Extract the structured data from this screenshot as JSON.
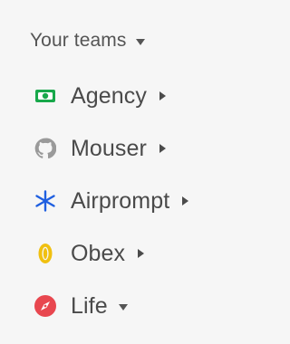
{
  "section": {
    "title": "Your teams",
    "expanded": true,
    "caret_icon": "caret-down-icon"
  },
  "teams": [
    {
      "label": "Agency",
      "icon": "money-bill-icon",
      "color": "#18a84b",
      "expanded": false
    },
    {
      "label": "Mouser",
      "icon": "github-icon",
      "color": "#9a9a9a",
      "expanded": false
    },
    {
      "label": "Airprompt",
      "icon": "asterisk-icon",
      "color": "#1f5fe0",
      "expanded": false
    },
    {
      "label": "Obex",
      "icon": "ring-icon",
      "color": "#f0c010",
      "expanded": false
    },
    {
      "label": "Life",
      "icon": "compass-icon",
      "color": "#e8474f",
      "expanded": true
    }
  ]
}
